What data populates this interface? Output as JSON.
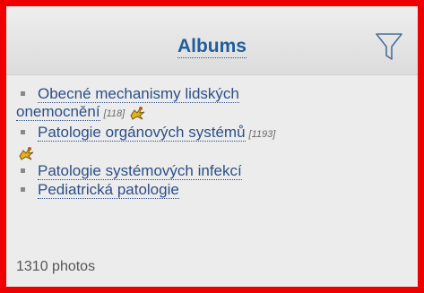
{
  "header": {
    "title": "Albums",
    "filter_icon": "filter-funnel-icon"
  },
  "albums": [
    {
      "label_line1": "Obecné mechanismy lidských",
      "label_line2": "onemocnění",
      "count": "[118]",
      "icon": "new-sparkle-icon"
    },
    {
      "label": "Patologie orgánových systémů",
      "count": "[1193]",
      "icon": "new-sparkle-icon"
    },
    {
      "label": "Patologie systémových infekcí"
    },
    {
      "label": "Pediatrická patologie"
    }
  ],
  "footer": {
    "photos": "1310 photos"
  },
  "colors": {
    "frame": "#ee0000",
    "link": "#2c4f86",
    "title": "#1f5d9c"
  }
}
